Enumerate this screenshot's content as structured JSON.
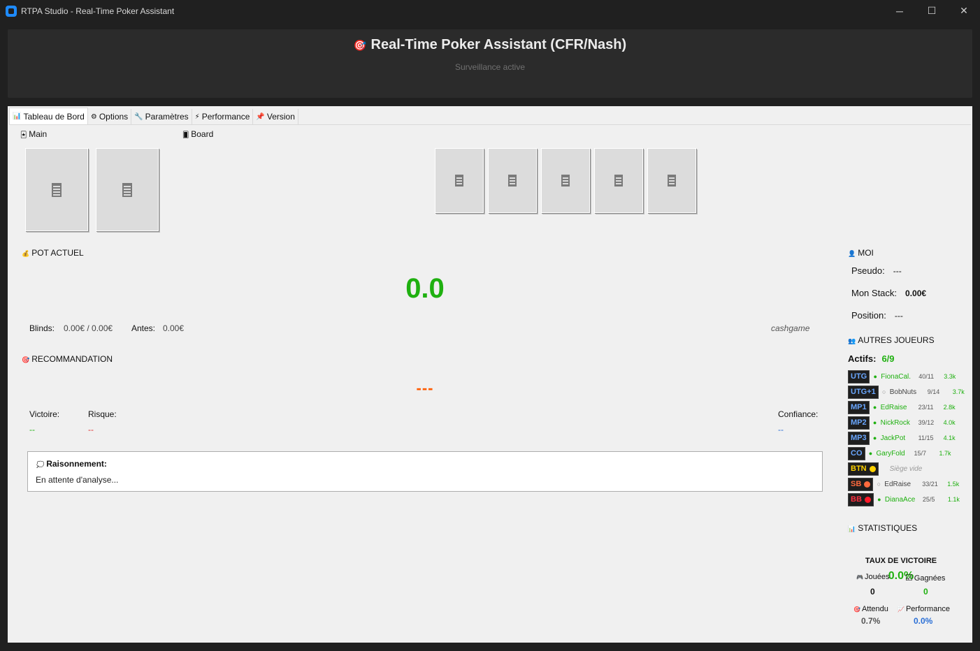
{
  "window": {
    "title": "RTPA Studio - Real-Time Poker Assistant",
    "controls": {
      "minimize": "─",
      "maximize": "☐",
      "close": "✕"
    }
  },
  "header": {
    "icon": "🎯",
    "title": "Real-Time Poker Assistant (CFR/Nash)",
    "subtitle": "Surveillance active"
  },
  "tabs": [
    {
      "icon": "📊",
      "label": "Tableau de Bord",
      "active": true
    },
    {
      "icon": "⚙",
      "label": "Options",
      "active": false
    },
    {
      "icon": "🔧",
      "label": "Paramètres",
      "active": false
    },
    {
      "icon": "⚡",
      "label": "Performance",
      "active": false
    },
    {
      "icon": "📌",
      "label": "Version",
      "active": false
    }
  ],
  "hand": {
    "icon": "🃏",
    "label": "Main",
    "card_count": 2
  },
  "board": {
    "icon": "🂠",
    "label": "Board",
    "card_count": 5
  },
  "pot": {
    "icon": "💰",
    "label": "POT ACTUEL",
    "value": "0.0",
    "blinds_label": "Blinds:",
    "blinds_value": "0.00€ / 0.00€",
    "antes_label": "Antes:",
    "antes_value": "0.00€",
    "mode": "cashgame"
  },
  "recommendation": {
    "icon": "🎯",
    "label": "RECOMMANDATION",
    "value": "---",
    "victory_label": "Victoire:",
    "victory_value": "--",
    "risk_label": "Risque:",
    "risk_value": "--",
    "confidence_label": "Confiance:",
    "confidence_value": "--",
    "reasoning_icon": "💭",
    "reasoning_title": "Raisonnement:",
    "reasoning_text": "En attente d'analyse..."
  },
  "me": {
    "icon": "👤",
    "label": "MOI",
    "pseudo_label": "Pseudo:",
    "pseudo_value": "---",
    "stack_label": "Mon Stack:",
    "stack_value": "0.00€",
    "position_label": "Position:",
    "position_value": "---"
  },
  "others": {
    "icon": "👥",
    "label": "AUTRES JOUEURS",
    "active_label": "Actifs:",
    "active_value": "6/9",
    "players": [
      {
        "pos": "UTG",
        "dot": "●",
        "name": "FionaCal.",
        "stats": "40/11",
        "stack": "3.3k",
        "active": true
      },
      {
        "pos": "UTG+1",
        "dot": "○",
        "name": "BobNuts",
        "stats": "9/14",
        "stack": "3.7k",
        "active": false
      },
      {
        "pos": "MP1",
        "dot": "●",
        "name": "EdRaise",
        "stats": "23/11",
        "stack": "2.8k",
        "active": true
      },
      {
        "pos": "MP2",
        "dot": "●",
        "name": "NickRock",
        "stats": "39/12",
        "stack": "4.0k",
        "active": true
      },
      {
        "pos": "MP3",
        "dot": "●",
        "name": "JackPot",
        "stats": "11/15",
        "stack": "4.1k",
        "active": true
      },
      {
        "pos": "CO",
        "dot": "●",
        "name": "GaryFold",
        "stats": "15/7",
        "stack": "1.7k",
        "active": true
      },
      {
        "pos": "BTN",
        "dot": "",
        "name": "Siège vide",
        "stats": "",
        "stack": "",
        "active": false,
        "chip": "#ffd200"
      },
      {
        "pos": "SB",
        "dot": "○",
        "name": "EdRaise",
        "stats": "33/21",
        "stack": "1.5k",
        "active": false,
        "chip": "#ff6a3d"
      },
      {
        "pos": "BB",
        "dot": "●",
        "name": "DianaAce",
        "stats": "25/5",
        "stack": "1.1k",
        "active": true,
        "chip": "#ff1a2a"
      }
    ]
  },
  "stats": {
    "icon": "📊",
    "label": "STATISTIQUES",
    "win_rate_label": "TAUX DE VICTOIRE",
    "win_rate_value": "0.0%",
    "played_icon": "🎮",
    "played_label": "Jouées",
    "played_value": "0",
    "won_icon": "☑",
    "won_label": "Gagnées",
    "won_value": "0",
    "expected_icon": "🎯",
    "expected_label": "Attendu",
    "expected_value": "0.7%",
    "perf_icon": "📈",
    "perf_label": "Performance",
    "perf_value": "0.0%"
  },
  "colors": {
    "accent_green": "#1fb010",
    "accent_orange": "#ff5a00",
    "accent_blue": "#2a6fd6",
    "danger_red": "#e03030"
  }
}
